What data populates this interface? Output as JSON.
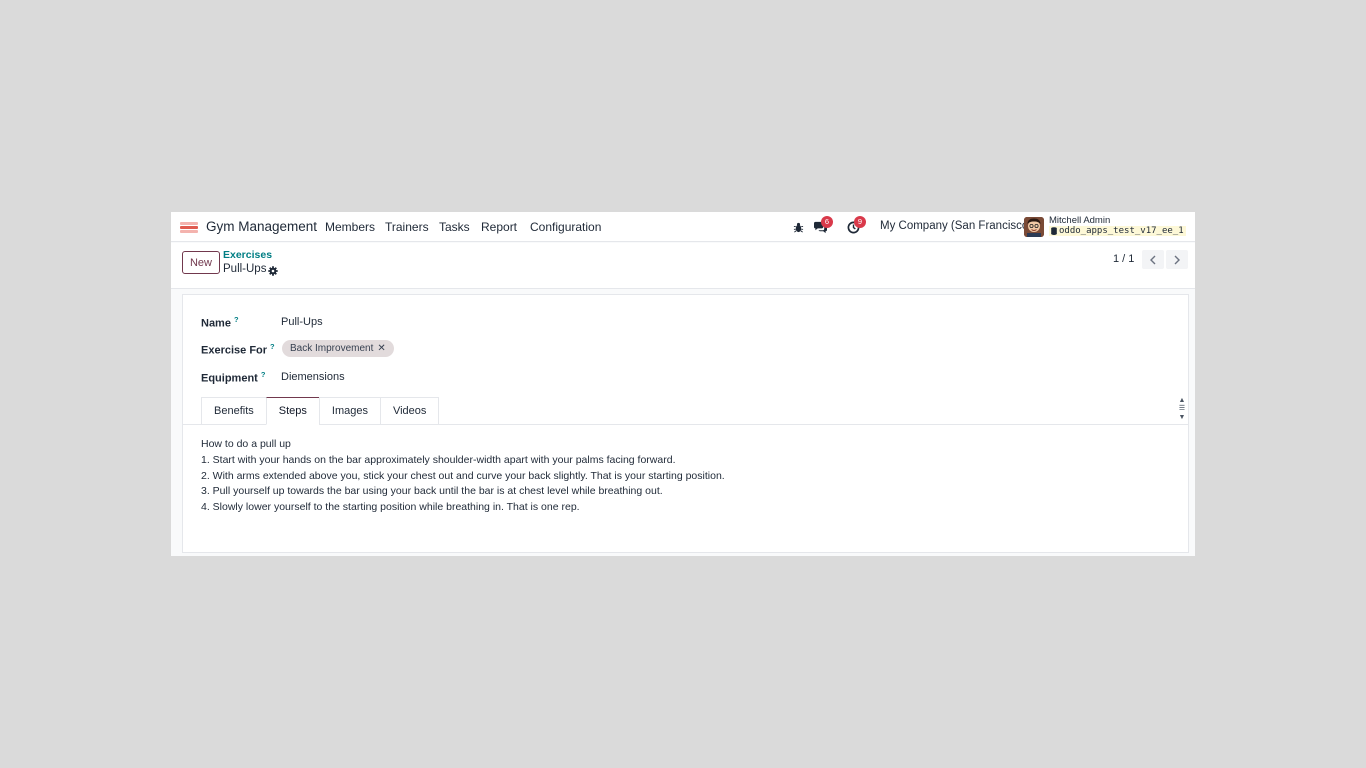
{
  "navbar": {
    "app_name": "Gym Management",
    "menu": [
      "Members",
      "Trainers",
      "Tasks",
      "Report",
      "Configuration"
    ],
    "messages_count": "6",
    "activities_count": "9",
    "company": "My Company (San Francisco)",
    "user_name": "Mitchell Admin",
    "database": "oddo_apps_test_v17_ee_1"
  },
  "control_panel": {
    "new_label": "New",
    "breadcrumb_parent": "Exercises",
    "breadcrumb_current": "Pull-Ups",
    "pager_value": "1 / 1"
  },
  "form": {
    "name_label": "Name",
    "name_value": "Pull-Ups",
    "exercise_for_label": "Exercise For",
    "exercise_for_tags": [
      "Back Improvement"
    ],
    "equipment_label": "Equipment",
    "equipment_value": "Diemensions",
    "help_marker": "?"
  },
  "tabs": [
    "Benefits",
    "Steps",
    "Images",
    "Videos"
  ],
  "active_tab": "Steps",
  "steps_content": [
    "How to do a pull up",
    "1. Start with your hands on the bar approximately shoulder-width apart with your palms facing forward.",
    "2. With arms extended above you, stick your chest out and curve your back slightly. That is your starting position.",
    "3. Pull yourself up towards the bar using your back until the bar is at chest level while breathing out.",
    "4. Slowly lower yourself to the starting position while breathing in. That is one rep."
  ],
  "colors": {
    "brand": "#71384d",
    "link": "#017e84",
    "badge": "#d9394a"
  }
}
